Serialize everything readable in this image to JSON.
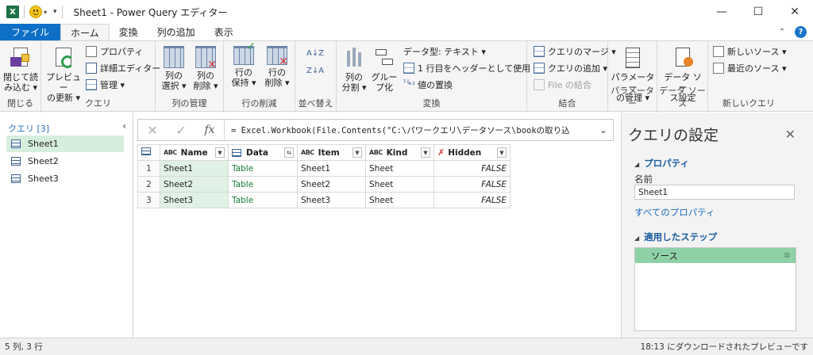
{
  "window": {
    "app_icon_letter": "X",
    "title": "Sheet1 - Power Query エディター",
    "minimize": "—",
    "maximize": "☐",
    "close": "✕"
  },
  "menu": {
    "tabs": [
      {
        "label": "ファイル"
      },
      {
        "label": "ホーム"
      },
      {
        "label": "変換"
      },
      {
        "label": "列の追加"
      },
      {
        "label": "表示"
      }
    ],
    "help_label": "?"
  },
  "ribbon": {
    "groups": {
      "close": {
        "label": "閉じる",
        "btn_line1": "閉じて読",
        "btn_line2": "み込む ▾"
      },
      "query": {
        "label": "クエリ",
        "refresh_line1": "プレビュー",
        "refresh_line2": "の更新 ▾",
        "properties": "プロパティ",
        "advanced_editor": "詳細エディター",
        "manage": "管理 ▾"
      },
      "manage_columns": {
        "label": "列の管理",
        "choose_line1": "列の",
        "choose_line2": "選択 ▾",
        "remove_line1": "列の",
        "remove_line2": "削除 ▾"
      },
      "reduce_rows": {
        "label": "行の削減",
        "keep_line1": "行の",
        "keep_line2": "保持 ▾",
        "remove_line1": "行の",
        "remove_line2": "削除 ▾"
      },
      "sort": {
        "label": "並べ替え",
        "asc": "A↓Z",
        "desc": "Z↓A"
      },
      "transform": {
        "label": "変換",
        "split_line1": "列の",
        "split_line2": "分割 ▾",
        "group_line1": "グルー",
        "group_line2": "プ化",
        "datatype": "データ型: テキスト ▾",
        "header": "1 行目をヘッダーとして使用 ▾",
        "replace": "値の置換"
      },
      "combine": {
        "label": "結合",
        "merge": "クエリのマージ ▾",
        "append": "クエリの追加 ▾",
        "combine_files": "File の結合"
      },
      "parameters": {
        "label": "パラメーター",
        "btn_line1": "パラメーター",
        "btn_line2": "の管理 ▾"
      },
      "datasource": {
        "label": "データ ソース",
        "btn_line1": "データ ソー",
        "btn_line2": "ス設定"
      },
      "newquery": {
        "label": "新しいクエリ",
        "new_source": "新しいソース ▾",
        "recent_source": "最近のソース ▾"
      }
    }
  },
  "queries": {
    "header": "クエリ [3]",
    "collapse": "‹",
    "items": [
      {
        "label": "Sheet1",
        "selected": true
      },
      {
        "label": "Sheet2",
        "selected": false
      },
      {
        "label": "Sheet3",
        "selected": false
      }
    ]
  },
  "formula": {
    "cancel": "✕",
    "confirm": "✓",
    "fx": "fx",
    "text": "= Excel.Workbook(File.Contents(\"C:\\パワークエリ\\データソース\\bookの取り込",
    "expand": "⌄"
  },
  "table": {
    "columns": [
      {
        "name": "Name",
        "type": "text"
      },
      {
        "name": "Data",
        "type": "table"
      },
      {
        "name": "Item",
        "type": "text"
      },
      {
        "name": "Kind",
        "type": "text"
      },
      {
        "name": "Hidden",
        "type": "bool"
      }
    ],
    "type_text_label": "ABC",
    "rows": [
      {
        "num": "1",
        "name": "Sheet1",
        "data": "Table",
        "item": "Sheet1",
        "kind": "Sheet",
        "hidden": "FALSE"
      },
      {
        "num": "2",
        "name": "Sheet2",
        "data": "Table",
        "item": "Sheet2",
        "kind": "Sheet",
        "hidden": "FALSE"
      },
      {
        "num": "3",
        "name": "Sheet3",
        "data": "Table",
        "item": "Sheet3",
        "kind": "Sheet",
        "hidden": "FALSE"
      }
    ]
  },
  "settings": {
    "title": "クエリの設定",
    "close": "✕",
    "properties_header": "プロパティ",
    "name_label": "名前",
    "name_value": "Sheet1",
    "all_properties": "すべてのプロパティ",
    "steps_header": "適用したステップ",
    "steps": [
      {
        "label": "ソース"
      }
    ]
  },
  "status": {
    "left": "5 列, 3 行",
    "right": "18:13 にダウンロードされたプレビューです"
  },
  "colors": {
    "file_tab": "#0e6fc7",
    "selected_query": "#d6eedd",
    "step_selected": "#8fd1a7",
    "link": "#1a6cc2"
  }
}
